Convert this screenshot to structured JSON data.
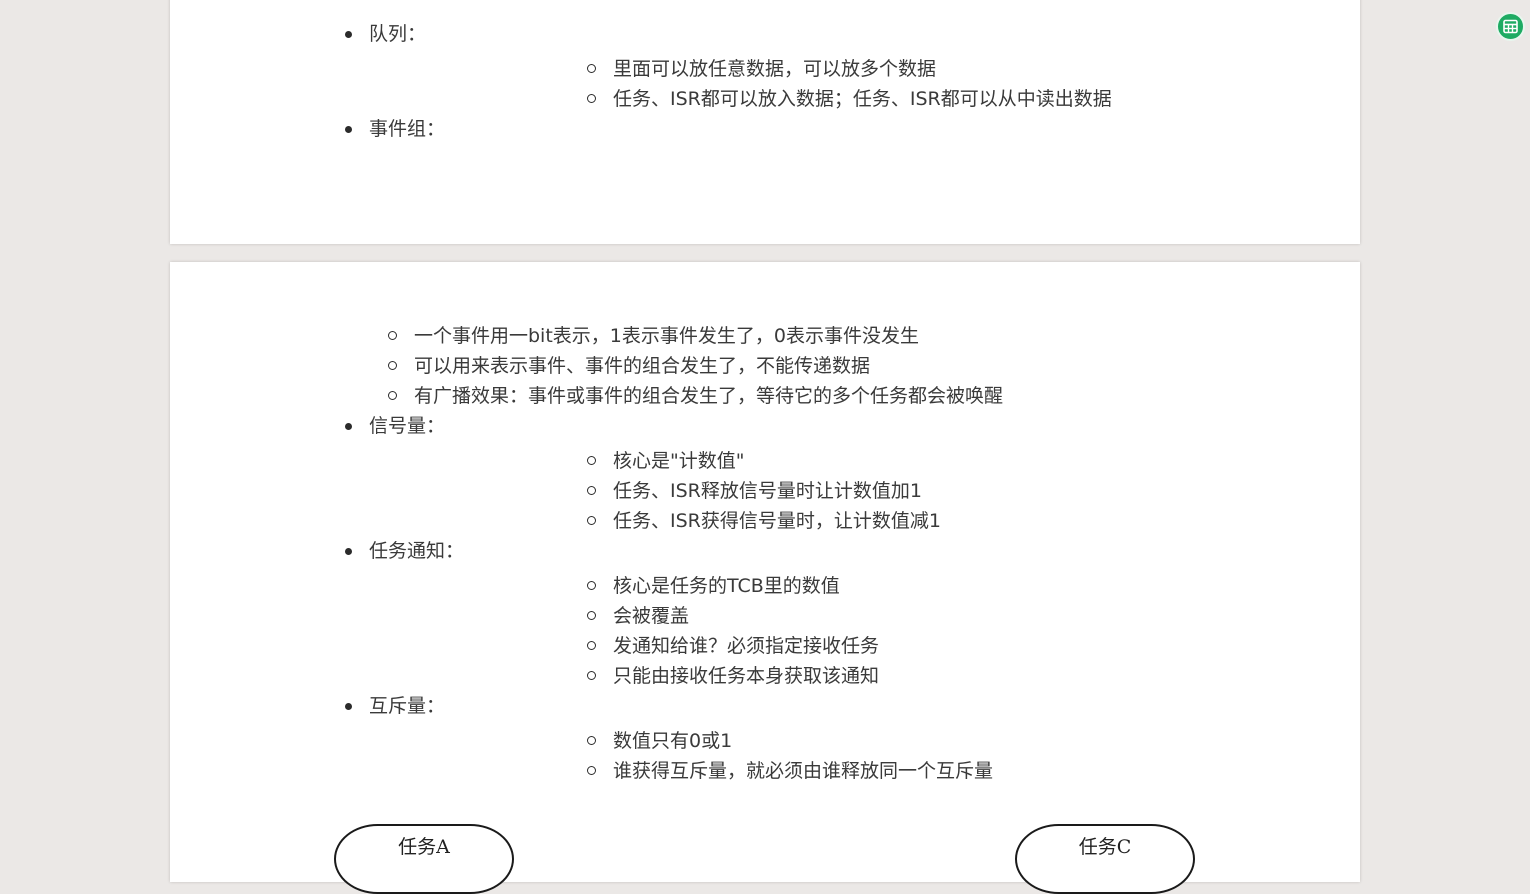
{
  "page1": {
    "items": [
      {
        "label": "队列：",
        "children": [
          "里面可以放任意数据，可以放多个数据",
          "任务、ISR都可以放入数据；任务、ISR都可以从中读出数据"
        ]
      },
      {
        "label": "事件组：",
        "children": []
      }
    ]
  },
  "page2": {
    "event_group_children": [
      "一个事件用一bit表示，1表示事件发生了，0表示事件没发生",
      "可以用来表示事件、事件的组合发生了，不能传递数据",
      "有广播效果：事件或事件的组合发生了，等待它的多个任务都会被唤醒"
    ],
    "items": [
      {
        "label": "信号量：",
        "children": [
          "核心是\"计数值\"",
          "任务、ISR释放信号量时让计数值加1",
          "任务、ISR获得信号量时，让计数值减1"
        ]
      },
      {
        "label": "任务通知：",
        "children": [
          "核心是任务的TCB里的数值",
          "会被覆盖",
          "发通知给谁？必须指定接收任务",
          "只能由接收任务本身获取该通知"
        ]
      },
      {
        "label": "互斥量：",
        "children": [
          "数值只有0或1",
          "谁获得互斥量，就必须由谁释放同一个互斥量"
        ]
      }
    ],
    "diagram": {
      "task_a": "任务A",
      "task_c": "任务C"
    }
  },
  "extension_icon": {
    "icon": "table-icon",
    "color": "#1eab63"
  }
}
